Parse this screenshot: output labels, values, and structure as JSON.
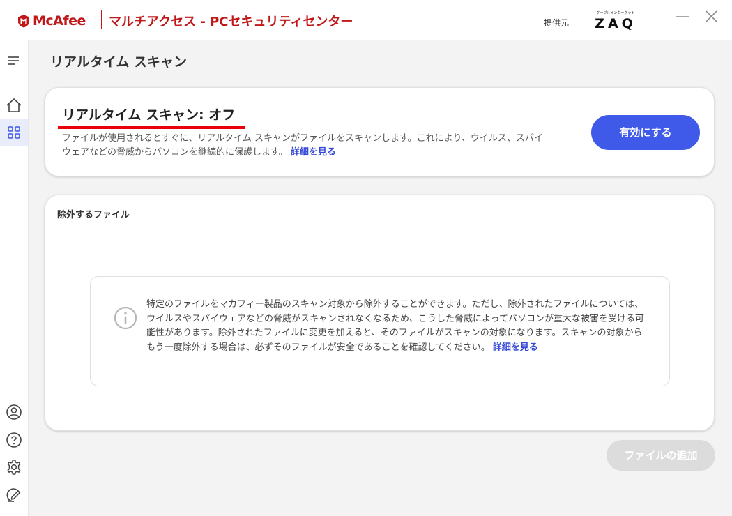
{
  "window": {
    "brand": "McAfee",
    "title": "マルチアクセス - PCセキュリティセンター",
    "provider_label": "提供元",
    "provider_logo_small": "ケーブルインターネット",
    "provider_logo_big": "ZAQ"
  },
  "colors": {
    "brand_red": "#c01818",
    "accent_blue": "#3f5ae8",
    "link_blue": "#3349d6",
    "underline_red": "#e8000a",
    "disabled_gray": "#dcdcdc"
  },
  "sidebar": {
    "items": [
      {
        "icon": "menu-icon"
      },
      {
        "icon": "home-icon"
      },
      {
        "icon": "apps-grid-icon",
        "active": true
      },
      {
        "icon": "account-icon"
      },
      {
        "icon": "help-icon"
      },
      {
        "icon": "settings-icon"
      },
      {
        "icon": "feedback-icon"
      }
    ]
  },
  "page": {
    "title": "リアルタイム スキャン"
  },
  "status_card": {
    "title": "リアルタイム スキャン: オフ",
    "description": "ファイルが使用されるとすぐに、リアルタイム スキャンがファイルをスキャンします。これにより、ウイルス、スパイウェアなどの脅威からパソコンを継続的に保護します。",
    "link": "詳細を見る",
    "enable_button": "有効にする"
  },
  "exclusions": {
    "title": "除外するファイル",
    "info_text": "特定のファイルをマカフィー製品のスキャン対象から除外することができます。ただし、除外されたファイルについては、ウイルスやスパイウェアなどの脅威がスキャンされなくなるため、こうした脅威によってパソコンが重大な被害を受ける可能性があります。除外されたファイルに変更を加えると、そのファイルがスキャンの対象になります。スキャンの対象からもう一度除外する場合は、必ずそのファイルが安全であることを確認してください。",
    "info_link": "詳細を見る",
    "add_button": "ファイルの追加"
  }
}
